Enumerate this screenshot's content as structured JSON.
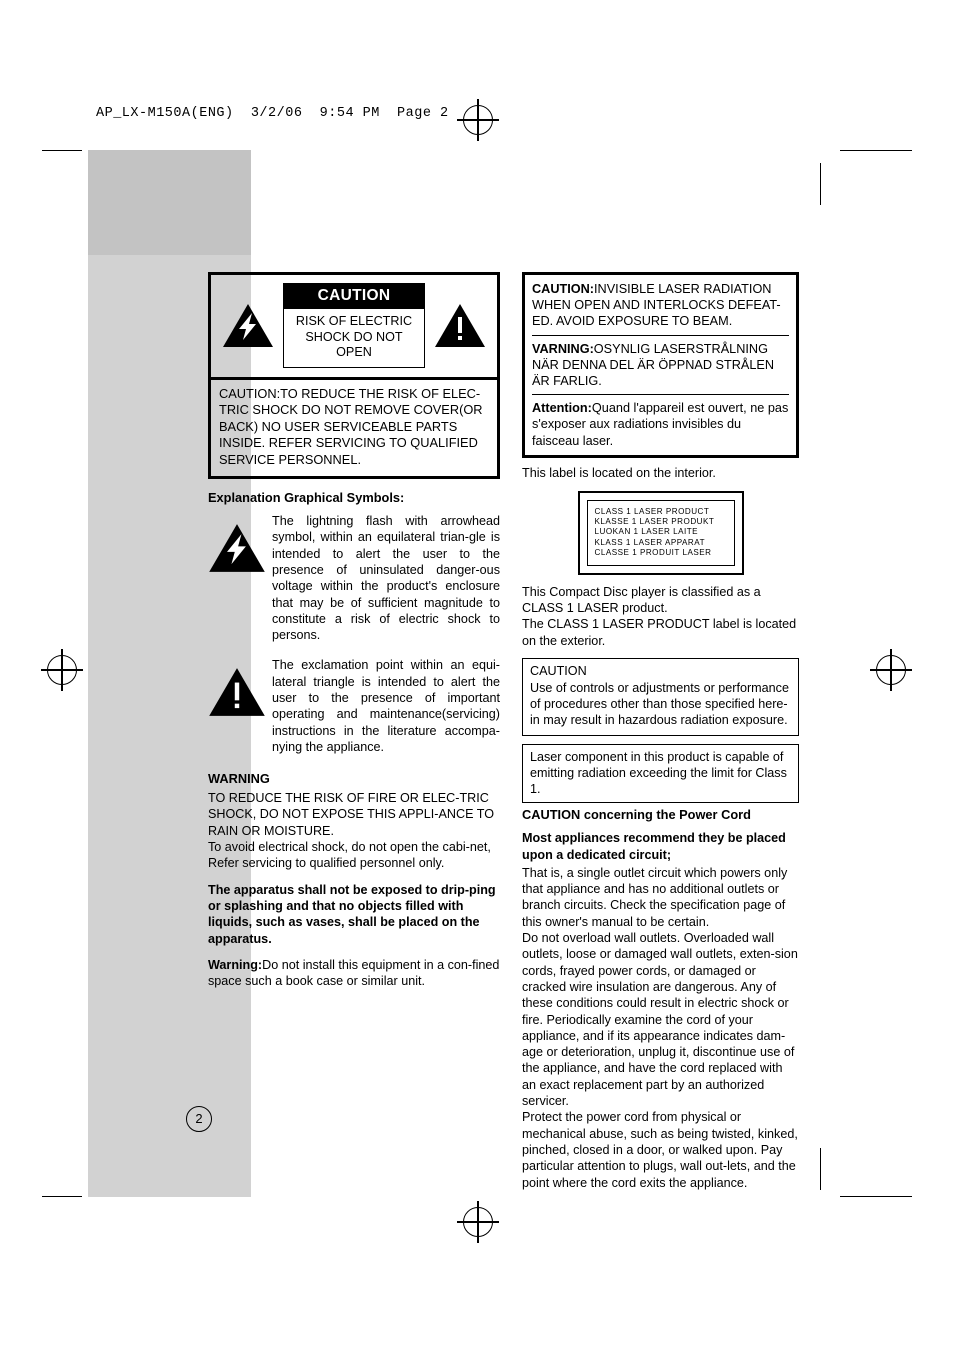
{
  "page": {
    "header_line": "AP_LX-M150A(ENG)  3/2/06  9:54 PM  Page 2",
    "page_number": "2"
  },
  "left": {
    "caution_box": {
      "title": "CAUTION",
      "subtitle": "RISK OF ELECTRIC\nSHOCK DO NOT OPEN",
      "body": "CAUTION:TO REDUCE THE RISK OF ELEC-TRIC SHOCK DO NOT REMOVE COVER(OR BACK) NO USER SERVICEABLE PARTS INSIDE. REFER SERVICING TO QUALIFIED SERVICE PERSONNEL."
    },
    "symbols_heading": "Explanation Graphical Symbols:",
    "lightning_text": "The lightning flash with arrowhead symbol, within an  equilateral  trian-gle is intended to alert the user to the presence of uninsulated danger-ous voltage within the product's enclosure that may be of sufficient magnitude to constitute a risk of electric shock to persons.",
    "exclamation_text": "The exclamation point within an equi-lateral triangle is intended to alert the user to the presence of important operating and maintenance(servicing) instructions in the literature accompa-nying the appliance.",
    "warning_heading": "WARNING",
    "warning_text": "TO REDUCE THE RISK OF FIRE OR ELEC-TRIC SHOCK, DO NOT EXPOSE THIS APPLI-ANCE TO RAIN OR MOISTURE.",
    "warning_text2": "To avoid electrical shock, do not open the cabi-net, Refer servicing to qualified    personnel only.",
    "apparatus_text": "The apparatus shall not be exposed to drip-ping or splashing and that no objects filled with liquids, such as vases, shall be placed on the apparatus.",
    "warning2_label": "Warning:",
    "warning2_text": "Do not install this equipment in a con-fined space such a book case or similar unit."
  },
  "right": {
    "laser_box": {
      "caution_label": "CAUTION:",
      "caution_text": "INVISIBLE LASER RADIATION WHEN OPEN AND INTERLOCKS DEFEAT-ED. AVOID EXPOSURE TO BEAM.",
      "varning_label": "VARNING:",
      "varning_text": "OSYNLIG LASERSTRÅLNING NÄR DENNA DEL ÄR ÖPPNAD STRÅLEN ÄR FARLIG.",
      "attention_label": "Attention:",
      "attention_text": "Quand l'appareil est ouvert, ne pas s'exposer aux radiations invisibles du faisceau laser."
    },
    "label_location": "This label is located on the interior.",
    "class1_lines": [
      "CLASS  1   LASER  PRODUCT",
      "KLASSE 1  LASER  PRODUKT",
      "LUOKAN 1 LASER  LAITE",
      "KLASS   1   LASER  APPARAT",
      "CLASSE 1  PRODUIT LASER"
    ],
    "class1_caption_1": "This Compact Disc  player is classified as a CLASS 1 LASER product.",
    "class1_caption_2": "The CLASS 1 LASER PRODUCT label is located on the exterior.",
    "caution_box2": {
      "heading": "CAUTION",
      "text": "Use of controls or adjustments or performance of procedures other than those specified here-in may result in hazardous radiation exposure."
    },
    "laser_component_text": "Laser component in this product is capable of emitting radiation exceeding the limit for Class 1.",
    "power_cord_heading": "CAUTION concerning the Power Cord",
    "appliances_heading": "Most appliances recommend they be placed upon a dedicated circuit;",
    "para1": "That is, a single outlet circuit which powers only that appliance and has no additional outlets or branch circuits. Check the specification page of this owner's manual to be certain.",
    "para2": "Do not overload wall outlets. Overloaded wall outlets, loose or damaged wall outlets, exten-sion cords, frayed power cords, or damaged or cracked wire insulation are dangerous. Any of these conditions could result in electric shock or fire. Periodically examine the cord of your appliance, and if its appearance indicates dam-age or deterioration, unplug it, discontinue use of the appliance, and have the cord replaced with an exact replacement part by an authorized servicer.",
    "para3": "Protect the power cord from physical or mechanical abuse, such as being twisted, kinked, pinched, closed in a door, or walked upon. Pay particular attention to plugs, wall out-lets, and the point where the cord exits the appliance."
  }
}
